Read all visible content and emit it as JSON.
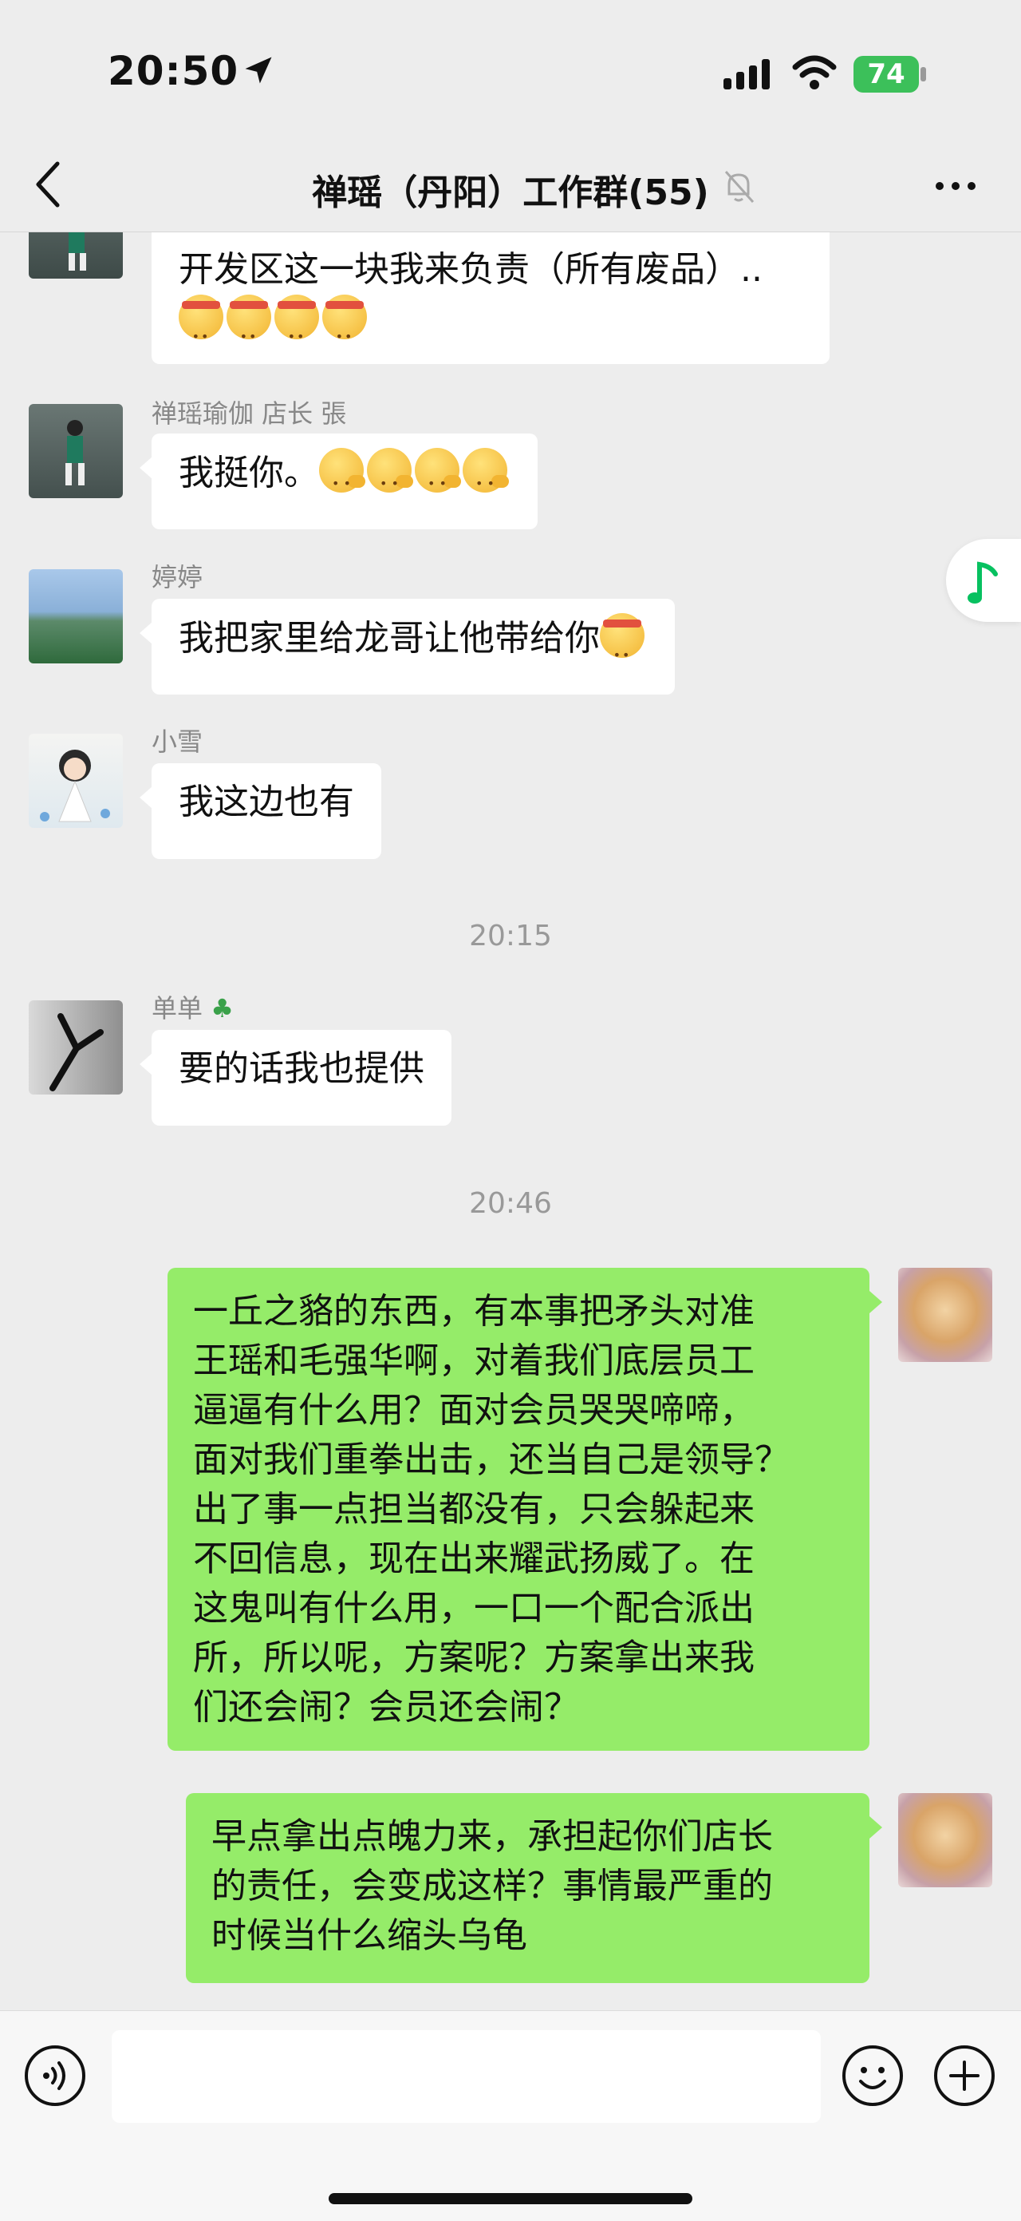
{
  "status_bar": {
    "time": "20:50",
    "battery": "74"
  },
  "nav": {
    "title": "禅瑶（丹阳）工作群(55)"
  },
  "messages": {
    "m0": {
      "text": "开发区这一块我来负责（所有废品）.."
    },
    "m1": {
      "sender": "禅瑶瑜伽 店长 張",
      "text": "我挺你。"
    },
    "m2": {
      "sender": "婷婷",
      "text": "我把家里给龙哥让他带给你"
    },
    "m3": {
      "sender": "小雪",
      "text": "我这边也有"
    },
    "ts1": "20:15",
    "m4": {
      "sender": "单单",
      "text": "要的话我也提供"
    },
    "ts2": "20:46",
    "m5": {
      "lines": [
        "一丘之貉的东西，有本事把矛头对准",
        "王瑶和毛强华啊，对着我们底层员工",
        "逼逼有什么用？面对会员哭哭啼啼，",
        "面对我们重拳出击，还当自己是领导？",
        "出了事一点担当都没有，只会躲起来",
        "不回信息，现在出来耀武扬威了。在",
        "这鬼叫有什么用，一口一个配合派出",
        "所，所以呢，方案呢？方案拿出来我",
        "们还会闹？会员还会闹？"
      ]
    },
    "m6": {
      "lines": [
        "早点拿出点魄力来，承担起你们店长",
        "的责任，会变成这样？事情最严重的",
        "时候当什么缩头乌龟"
      ]
    }
  },
  "icons": {
    "back": "chevron-left-icon",
    "mute": "bell-slash-icon",
    "more": "more-dots-icon",
    "voice": "voice-icon",
    "emoji": "emoji-icon",
    "plus": "plus-icon",
    "music": "music-note-icon"
  },
  "colors": {
    "background": "#ededed",
    "mine_bubble": "#95ec69",
    "other_bubble": "#ffffff",
    "accent": "#07c160",
    "battery": "#3cc05a"
  }
}
